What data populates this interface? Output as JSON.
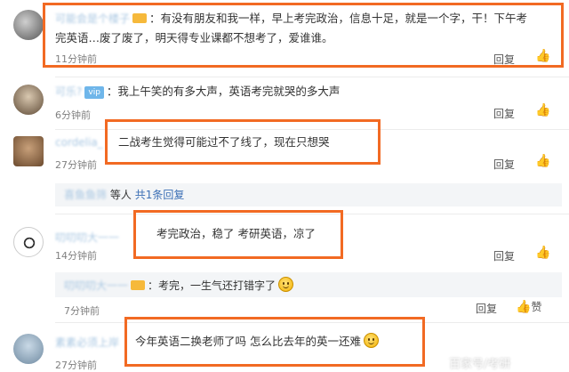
{
  "comments": [
    {
      "username": "可能会是个楼子",
      "text_line1": "：有没有朋友和我一样，早上考完政治，信息十足，就是一个字，干！下午考",
      "text_line2": "完英语…废了废了，明天得专业课都不想考了，爱谁谁。",
      "time": "11分钟前",
      "reply": "回复"
    },
    {
      "username": "可乐?",
      "text": "：我上午笑的有多大声，英语考完就哭的多大声",
      "time": "6分钟前",
      "reply": "回复"
    },
    {
      "username": "cordelia_",
      "text": "二战考生觉得可能过不了线了，现在只想哭",
      "time": "27分钟前",
      "reply": "回复",
      "sub_user": "喜鱼鱼筛",
      "sub_text": "等人",
      "sub_link": "共1条回复"
    },
    {
      "username": "叨叨叨大一一",
      "text": "考完政治，稳了 考研英语，凉了",
      "time": "14分钟前",
      "reply": "回复",
      "sub_user": "叨叨叨大一一",
      "sub_text": "：考完，一生气还打错字了",
      "sub_time": "7分钟前",
      "sub_reply": "回复",
      "sub_like": "赞"
    },
    {
      "username": "素素必须上岸",
      "text": "今年英语二换老师了吗 怎么比去年的英一还难",
      "time": "27分钟前"
    }
  ],
  "watermark": "百家号/考研",
  "icons": [
    "thumb-up-icon",
    "smiley-icon",
    "vip-badge-icon"
  ]
}
